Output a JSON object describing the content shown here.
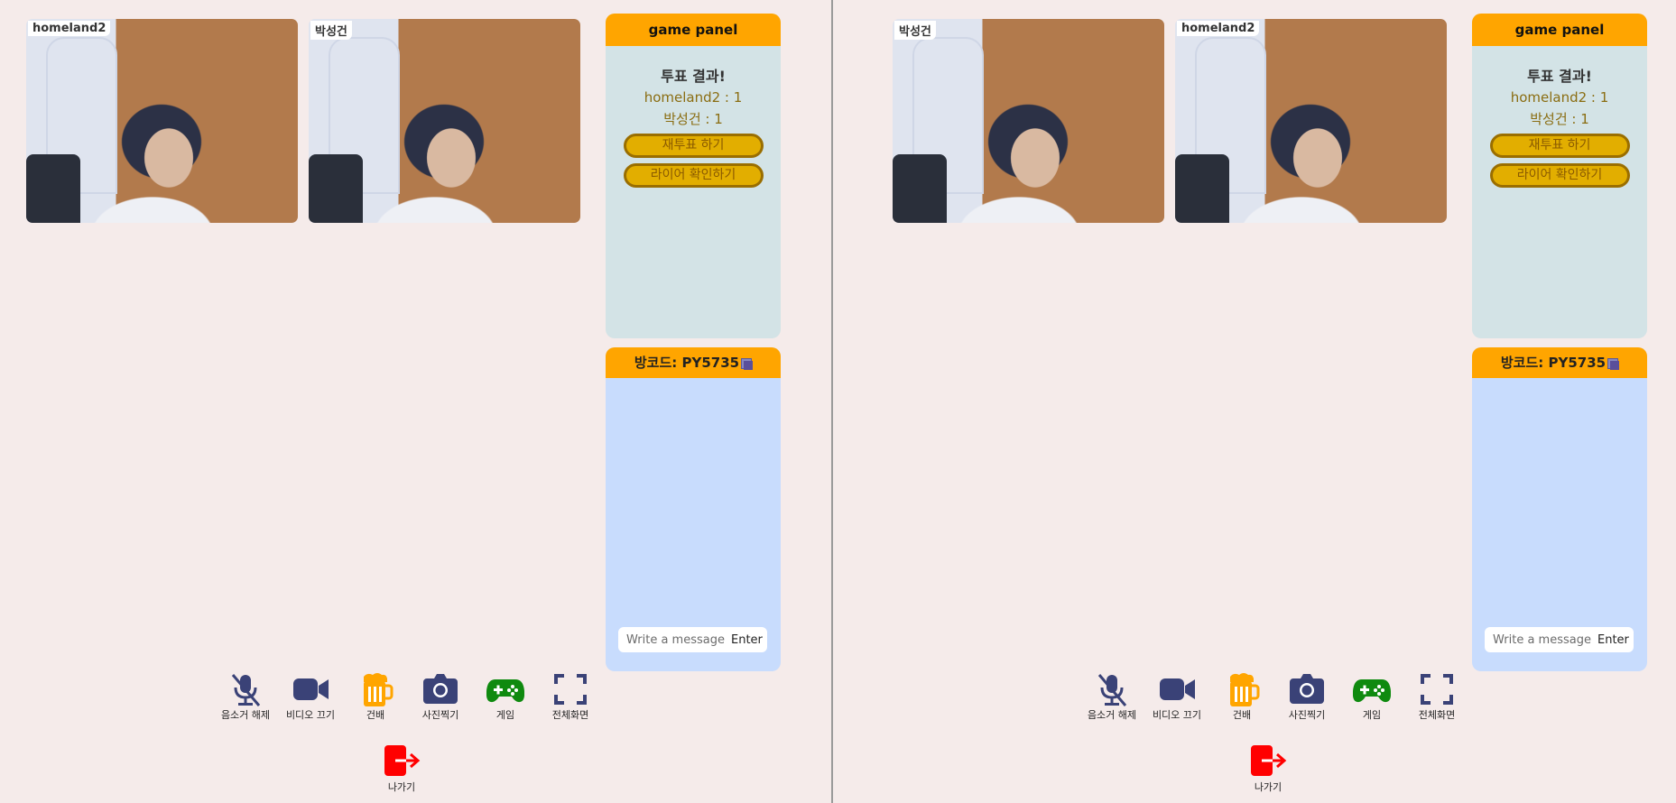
{
  "colors": {
    "background": "#f5ebea",
    "panel_header": "#ffa500",
    "panel_body": "#d3e3e6",
    "chat_body": "#c8dcfd",
    "button_fill": "#e2ae00",
    "icon_navy": "#3a4277",
    "beer_icon": "#ffa500",
    "game_icon": "#0f8a0f",
    "exit_icon": "#ff0000"
  },
  "left": {
    "videos": [
      {
        "name": "homeland2"
      },
      {
        "name": "박성건"
      }
    ],
    "game_panel": {
      "title": "game panel",
      "result_title": "투표 결과!",
      "votes": [
        "homeland2 : 1",
        "박성건 : 1"
      ],
      "revote_label": "재투표 하기",
      "check_liar_label": "라이어 확인하기"
    },
    "chat": {
      "room_code_label": "방코드: PY5735",
      "input_placeholder": "Write a message",
      "enter_label": "Enter"
    },
    "toolbar": {
      "mute_label": "음소거 해제",
      "video_label": "비디오 끄기",
      "cheers_label": "건배",
      "photo_label": "사진찍기",
      "game_label": "게임",
      "fullscreen_label": "전체화면",
      "exit_label": "나가기"
    }
  },
  "right": {
    "videos": [
      {
        "name": "박성건"
      },
      {
        "name": "homeland2"
      }
    ],
    "game_panel": {
      "title": "game panel",
      "result_title": "투표 결과!",
      "votes": [
        "homeland2 : 1",
        "박성건 : 1"
      ],
      "revote_label": "재투표 하기",
      "check_liar_label": "라이어 확인하기"
    },
    "chat": {
      "room_code_label": "방코드: PY5735",
      "input_placeholder": "Write a message",
      "enter_label": "Enter"
    },
    "toolbar": {
      "mute_label": "음소거 해제",
      "video_label": "비디오 끄기",
      "cheers_label": "건배",
      "photo_label": "사진찍기",
      "game_label": "게임",
      "fullscreen_label": "전체화면",
      "exit_label": "나가기"
    }
  }
}
